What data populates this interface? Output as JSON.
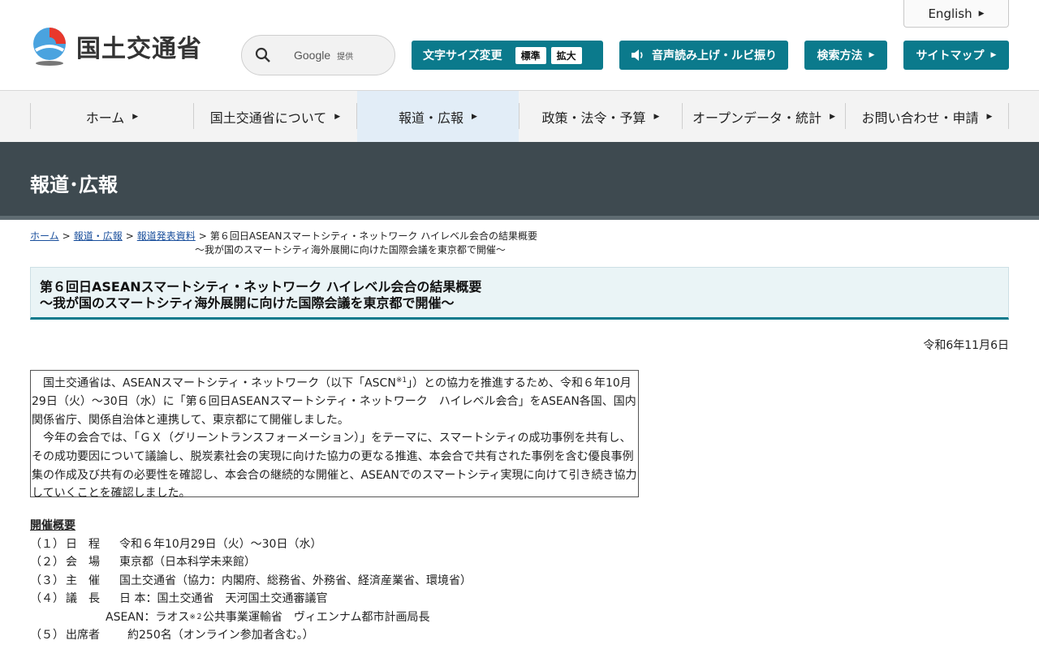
{
  "header": {
    "logo_text": "国土交通省",
    "english_label": "English",
    "search": {
      "google": "Google",
      "provided": "提供"
    },
    "font_size": {
      "label": "文字サイズ変更",
      "standard": "標準",
      "large": "拡大"
    },
    "voice_label": "音声読み上げ・ルビ振り",
    "search_method_label": "検索方法",
    "sitemap_label": "サイトマップ",
    "accent_color": "#0b7a8c"
  },
  "nav": {
    "items": [
      {
        "label": "ホーム"
      },
      {
        "label": "国土交通省について"
      },
      {
        "label": "報道・広報"
      },
      {
        "label": "政策・法令・予算"
      },
      {
        "label": "オープンデータ・統計"
      },
      {
        "label": "お問い合わせ・申請"
      }
    ]
  },
  "banner": {
    "title": "報道･広報"
  },
  "breadcrumb": {
    "items": [
      "ホーム",
      "報道・広報",
      "報道発表資料"
    ],
    "current_line1": "第６回日ASEANスマートシティ・ネットワーク ハイレベル会合の結果概要",
    "current_line2": "～我が国のスマートシティ海外展開に向けた国際会議を東京都で開催～"
  },
  "page_title": {
    "line1": "第６回日ASEANスマートシティ・ネットワーク ハイレベル会合の結果概要",
    "line2": "～我が国のスマートシティ海外展開に向けた国際会議を東京都で開催～"
  },
  "date": "令和6年11月6日",
  "summary": {
    "p1_before": "国土交通省は、ASEANスマートシティ・ネットワーク（以下「ASCN",
    "p1_sup": "※1",
    "p1_after": "」）との協力を推進するため、令和６年10月29日（火）～30日（水）に「第６回日ASEANスマートシティ・ネットワーク　ハイレベル会合」をASEAN各国、国内関係省庁、関係自治体と連携して、東京都にて開催しました。",
    "p2": "今年の会合では、「ＧＸ（グリーントランスフォーメーション）」をテーマに、スマートシティの成功事例を共有し、その成功要因について議論し、脱炭素社会の実現に向けた協力の更なる推進、本会合で共有された事例を含む優良事例集の作成及び共有の必要性を確認し、本会合の継続的な開催と、ASEANでのスマートシティ実現に向けて引き続き協力していくことを確認しました。"
  },
  "details": {
    "title": "開催概要",
    "rows": [
      {
        "num": "（１）",
        "label": "日　程",
        "value": "令和６年10月29日（火）～30日（水）"
      },
      {
        "num": "（２）",
        "label": "会　場",
        "value": "東京都（日本科学未来館）"
      },
      {
        "num": "（３）",
        "label": "主　催",
        "value": "国土交通省（協力：内閣府、総務省、外務省、経済産業省、環境省）"
      },
      {
        "num": "（４）",
        "label": "議　長",
        "value": "日 本：国土交通省　天河国土交通審議官"
      }
    ],
    "asean_before": "ASEAN：ラオス",
    "asean_sup": "※２",
    "asean_after": "公共事業運輸省　ヴィエンナム都市計画局長",
    "row5": {
      "num": "（５）",
      "label": "出席者",
      "value": "約250名（オンライン参加者含む。）"
    }
  }
}
